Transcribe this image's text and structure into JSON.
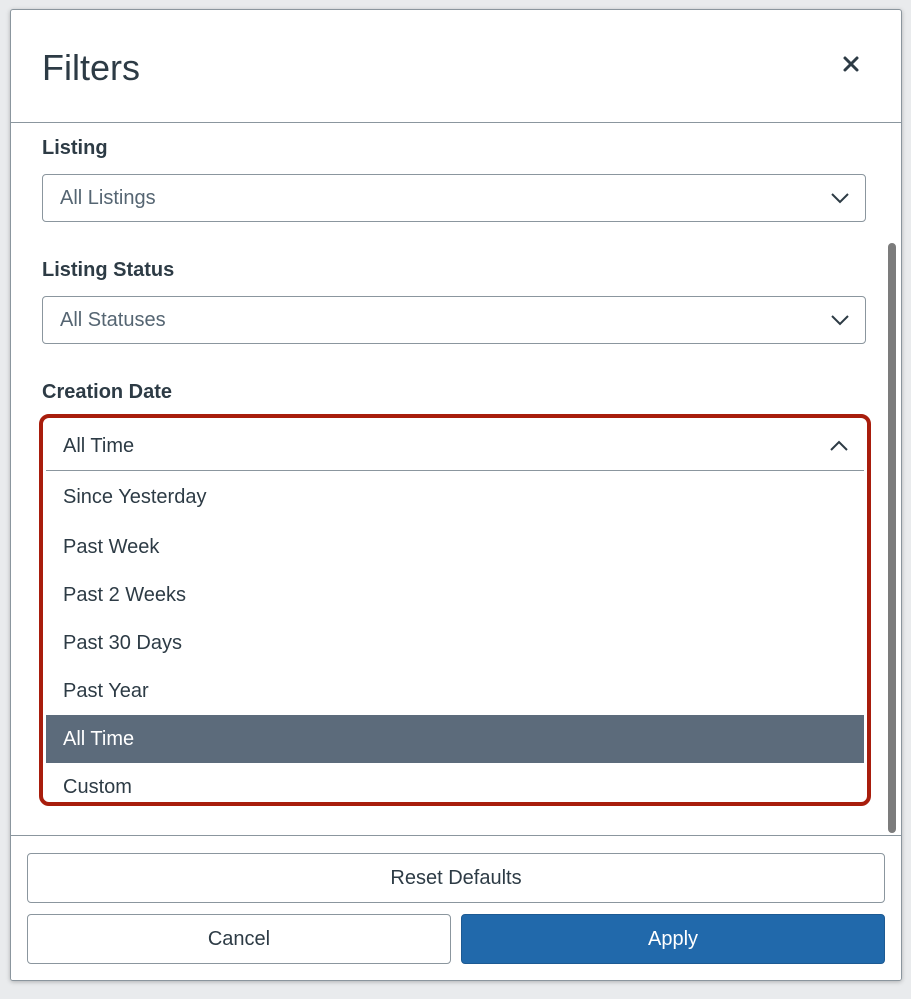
{
  "modal": {
    "title": "Filters",
    "close_icon": "close-icon"
  },
  "filters": {
    "listing": {
      "label": "Listing",
      "value": "All Listings"
    },
    "listing_status": {
      "label": "Listing Status",
      "value": "All Statuses"
    },
    "creation_date": {
      "label": "Creation Date",
      "value": "All Time",
      "options": [
        "Since Yesterday",
        "Past Week",
        "Past 2 Weeks",
        "Past 30 Days",
        "Past Year",
        "All Time",
        "Custom"
      ],
      "selected_option": "All Time"
    }
  },
  "footer": {
    "reset_label": "Reset Defaults",
    "cancel_label": "Cancel",
    "apply_label": "Apply"
  },
  "colors": {
    "primary": "#2169ab",
    "selected_option_bg": "#5c6b7b",
    "highlight_outline": "#a81d0c",
    "text": "#2d3b45"
  }
}
